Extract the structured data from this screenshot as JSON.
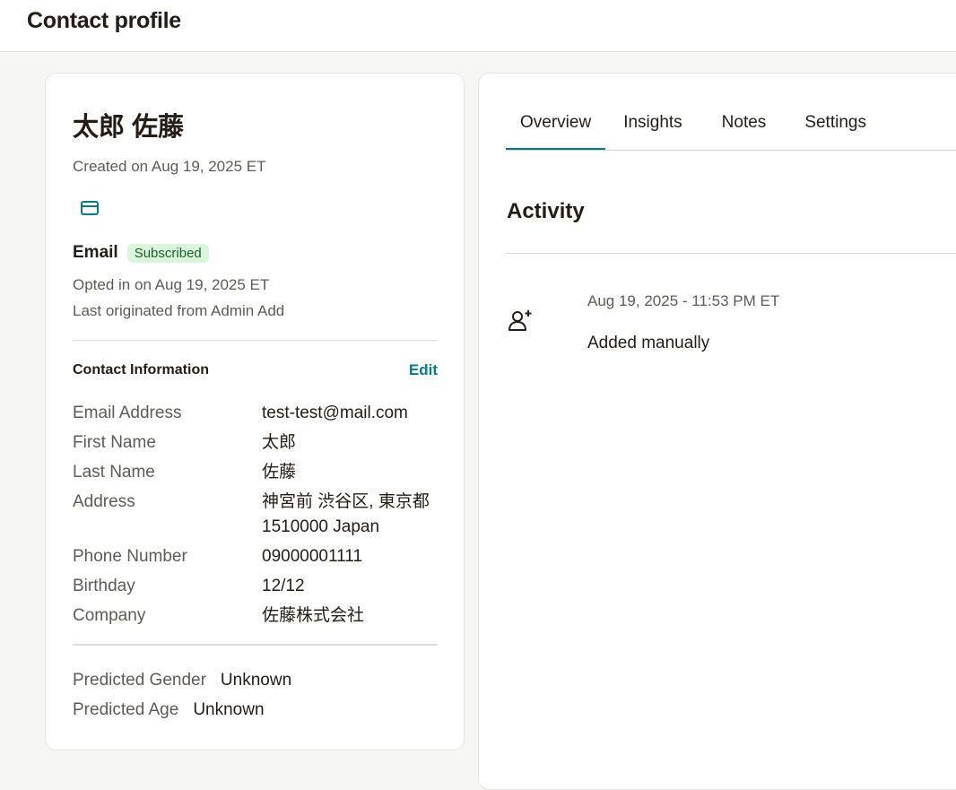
{
  "page": {
    "title": "Contact profile"
  },
  "contact": {
    "name": "太郎 佐藤",
    "created": "Created on Aug 19, 2025 ET",
    "email_label": "Email",
    "email_status": "Subscribed",
    "opted_in": "Opted in on Aug 19, 2025 ET",
    "originated": "Last originated from Admin Add"
  },
  "contact_info": {
    "title": "Contact Information",
    "edit_label": "Edit",
    "fields": [
      {
        "label": "Email Address",
        "value": "test-test@mail.com"
      },
      {
        "label": "First Name",
        "value": "太郎"
      },
      {
        "label": "Last Name",
        "value": "佐藤"
      },
      {
        "label": "Address",
        "value": "神宮前 渋谷区, 東京都 1510000 Japan"
      },
      {
        "label": "Phone Number",
        "value": "09000001111"
      },
      {
        "label": "Birthday",
        "value": "12/12"
      },
      {
        "label": "Company",
        "value": "佐藤株式会社"
      }
    ]
  },
  "predictions": {
    "gender_label": "Predicted Gender",
    "gender_value": "Unknown",
    "age_label": "Predicted Age",
    "age_value": "Unknown"
  },
  "tabs": [
    {
      "label": "Overview",
      "active": true
    },
    {
      "label": "Insights",
      "active": false
    },
    {
      "label": "Notes",
      "active": false
    },
    {
      "label": "Settings",
      "active": false
    }
  ],
  "activity": {
    "title": "Activity",
    "items": [
      {
        "icon": "user-add-icon",
        "time": "Aug 19, 2025 - 11:53 PM ET",
        "description": "Added manually"
      }
    ]
  },
  "colors": {
    "accent": "#007c89",
    "badge_bg": "#d9f6dd",
    "badge_text": "#1b5e2b",
    "text_primary": "#241c15",
    "text_secondary": "#5f5a55"
  }
}
